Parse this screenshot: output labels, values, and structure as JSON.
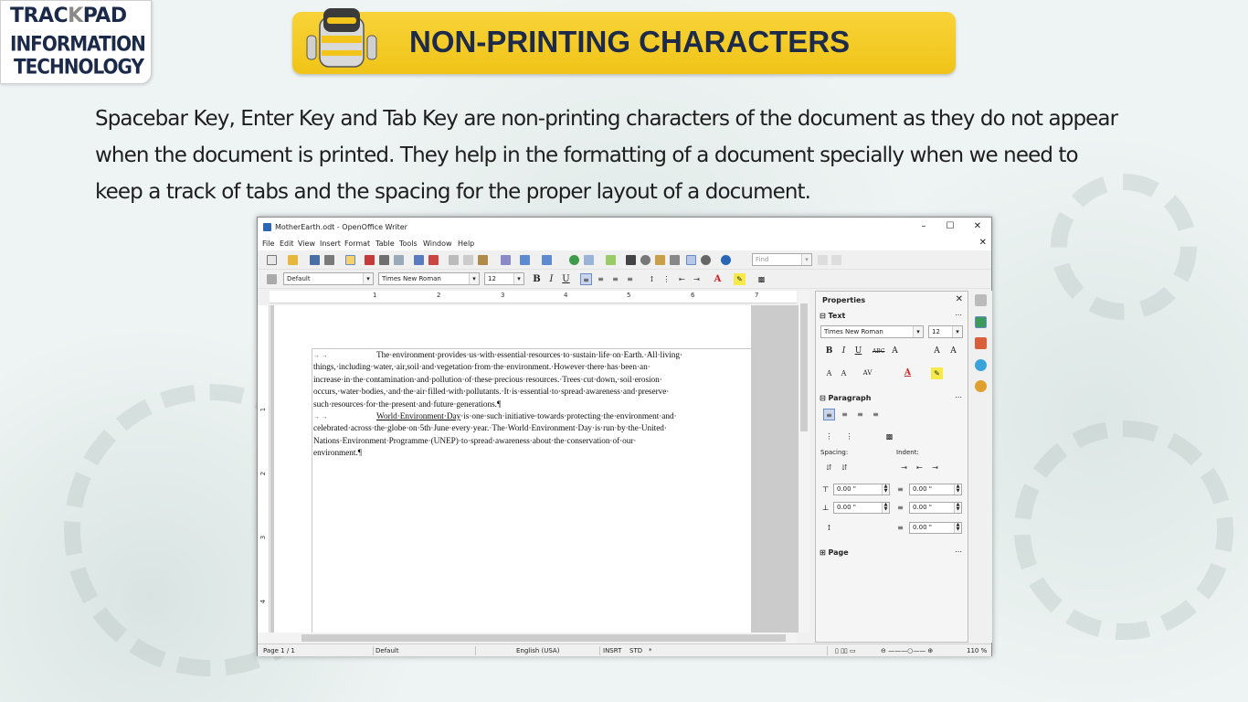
{
  "logo": {
    "line1_a": "TRAC",
    "line1_k": "K",
    "line1_b": "PAD",
    "line2": "INFORMATION",
    "line3": "TECHNOLOGY"
  },
  "banner": {
    "title": "NON-PRINTING CHARACTERS"
  },
  "intro": {
    "lines": [
      "Spacebar Key, Enter Key and Tab Key are non-printing characters of the document as they do not appear",
      "when the document is printed. They help in the formatting of a document specially when we need to",
      "keep a track of tabs and the spacing for the proper layout of a document."
    ]
  },
  "window": {
    "title": "MotherEarth.odt - OpenOffice Writer",
    "menu": [
      "File",
      "Edit",
      "View",
      "Insert",
      "Format",
      "Table",
      "Tools",
      "Window",
      "Help"
    ],
    "find_placeholder": "Find",
    "style_value": "Default",
    "font_value": "Times New Roman",
    "size_value": "12",
    "ruler_numbers": [
      "1",
      "2",
      "3",
      "4",
      "5",
      "6",
      "7"
    ],
    "vruler_numbers": [
      "1",
      "2",
      "3",
      "4"
    ],
    "doc": {
      "tab_mark": "→ → ",
      "p1_lines": [
        "The·environment·provides·us·with·essential·resources·to·sustain·life·on·Earth.·All·living·",
        "things,·including·water,·air,soil·and·vegetation·from·the·environment.·However·there·has·been·an·",
        "increase·in·the·contamination·and·pollution·of·these·precious·resources.·Trees·cut·down,·soil·erosion·",
        "occurs,·water·bodies,·and·the·air·filled·with·pollutants.·It·is·essential·to·spread·awareness·and·preserve·",
        "such·resources·for·the·present·and·future·generations.¶"
      ],
      "p2_underlined": "World·Environment·Day",
      "p2_first_rest": "·is·one·such·initiative·towards·protecting·the·environment·and·",
      "p2_lines": [
        "celebrated·across·the·globe·on·5th·June·every·year.·The·World·Environment·Day·is·run·by·the·United·",
        "Nations·Environment·Programme·(UNEP)·to·spread·awareness·about·the·conservation·of·our·",
        "environment.¶"
      ]
    },
    "sidebar": {
      "title": "Properties",
      "text_section": "Text",
      "font_value": "Times New Roman",
      "size_value": "12",
      "paragraph_section": "Paragraph",
      "spacing_label": "Spacing:",
      "indent_label": "Indent:",
      "spin_values": [
        "0.00 \"",
        "0.00 \"",
        "0.00 \"",
        "0.00 \"",
        "0.00 \""
      ],
      "page_section": "Page"
    },
    "status": {
      "page": "Page 1 / 1",
      "style": "Default",
      "language": "English (USA)",
      "insert": "INSRT",
      "selection": "STD",
      "zoom": "110 %"
    }
  },
  "colors": {
    "banner": "#f2c51c",
    "title_text": "#1d2a4a",
    "brand_navy": "#1c2a4a"
  }
}
